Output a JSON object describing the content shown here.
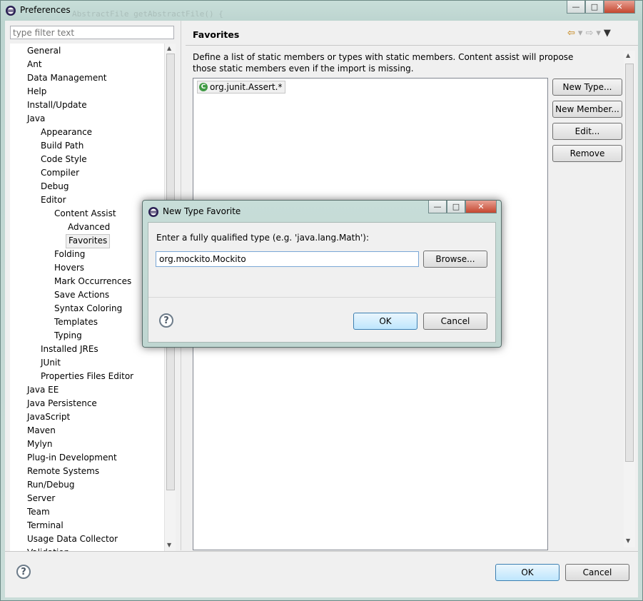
{
  "window": {
    "title": "Preferences",
    "background_code": "AbstractFile getAbstractFile() {"
  },
  "filter": {
    "placeholder": "type filter text"
  },
  "tree": {
    "items": [
      {
        "label": "General",
        "level": 0
      },
      {
        "label": "Ant",
        "level": 0
      },
      {
        "label": "Data Management",
        "level": 0
      },
      {
        "label": "Help",
        "level": 0
      },
      {
        "label": "Install/Update",
        "level": 0
      },
      {
        "label": "Java",
        "level": 0
      },
      {
        "label": "Appearance",
        "level": 1
      },
      {
        "label": "Build Path",
        "level": 1
      },
      {
        "label": "Code Style",
        "level": 1
      },
      {
        "label": "Compiler",
        "level": 1
      },
      {
        "label": "Debug",
        "level": 1
      },
      {
        "label": "Editor",
        "level": 1
      },
      {
        "label": "Content Assist",
        "level": 2
      },
      {
        "label": "Advanced",
        "level": 3
      },
      {
        "label": "Favorites",
        "level": 3,
        "selected": true
      },
      {
        "label": "Folding",
        "level": 2
      },
      {
        "label": "Hovers",
        "level": 2
      },
      {
        "label": "Mark Occurrences",
        "level": 2
      },
      {
        "label": "Save Actions",
        "level": 2
      },
      {
        "label": "Syntax Coloring",
        "level": 2
      },
      {
        "label": "Templates",
        "level": 2
      },
      {
        "label": "Typing",
        "level": 2
      },
      {
        "label": "Installed JREs",
        "level": 1
      },
      {
        "label": "JUnit",
        "level": 1
      },
      {
        "label": "Properties Files Editor",
        "level": 1
      },
      {
        "label": "Java EE",
        "level": 0
      },
      {
        "label": "Java Persistence",
        "level": 0
      },
      {
        "label": "JavaScript",
        "level": 0
      },
      {
        "label": "Maven",
        "level": 0
      },
      {
        "label": "Mylyn",
        "level": 0
      },
      {
        "label": "Plug-in Development",
        "level": 0
      },
      {
        "label": "Remote Systems",
        "level": 0
      },
      {
        "label": "Run/Debug",
        "level": 0
      },
      {
        "label": "Server",
        "level": 0
      },
      {
        "label": "Team",
        "level": 0
      },
      {
        "label": "Terminal",
        "level": 0
      },
      {
        "label": "Usage Data Collector",
        "level": 0
      },
      {
        "label": "Validation",
        "level": 0
      }
    ]
  },
  "page": {
    "title": "Favorites",
    "description": "Define a list of static members or types with static members. Content assist will propose those static members even if the import is missing.",
    "favorites": [
      "org.junit.Assert.*"
    ],
    "buttons": {
      "new_type": "New Type...",
      "new_member": "New Member...",
      "edit": "Edit...",
      "remove": "Remove"
    }
  },
  "footer": {
    "ok": "OK",
    "cancel": "Cancel"
  },
  "modal": {
    "title": "New Type Favorite",
    "label": "Enter a fully qualified type (e.g. 'java.lang.Math'):",
    "input_value": "org.mockito.Mockito",
    "browse": "Browse...",
    "ok": "OK",
    "cancel": "Cancel"
  },
  "icons": {
    "app": "eclipse-icon",
    "back": "back-arrow-icon",
    "forward": "forward-arrow-icon",
    "menu": "view-menu-icon",
    "help": "help-icon",
    "class": "class-icon"
  },
  "colors": {
    "accent": "#3c7fb1",
    "class_icon": "#3f9a44",
    "close_button": "#c4472f"
  }
}
